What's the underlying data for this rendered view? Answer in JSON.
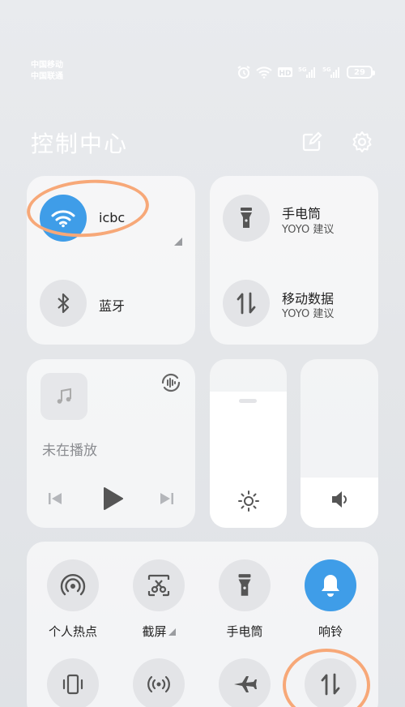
{
  "status_bar": {
    "carrier_1": "中国移动",
    "carrier_2": "中国联通",
    "battery": "29",
    "icons": [
      "alarm-icon",
      "wifi-icon",
      "hd-icon",
      "5g-signal-icon",
      "5g-signal-icon",
      "battery-icon"
    ]
  },
  "header": {
    "title": "控制中心",
    "edit_icon": "edit-icon",
    "settings_icon": "gear-icon"
  },
  "connectivity": {
    "wifi_label": "icbc",
    "wifi_active": true,
    "bluetooth_label": "蓝牙"
  },
  "suggestions": {
    "flashlight_label": "手电筒",
    "flashlight_sub": "YOYO 建议",
    "data_label": "移动数据",
    "data_sub": "YOYO 建议"
  },
  "media": {
    "status": "未在播放"
  },
  "sliders": {
    "brightness_level": 0.81,
    "volume_level": 0.3
  },
  "quick_settings": [
    {
      "label": "个人热点",
      "icon": "hotspot-icon",
      "active": false
    },
    {
      "label": "截屏",
      "icon": "screenshot-icon",
      "active": false
    },
    {
      "label": "手电筒",
      "icon": "flashlight-icon",
      "active": false
    },
    {
      "label": "响铃",
      "icon": "bell-icon",
      "active": true
    }
  ],
  "quick_settings_row2": [
    "vibrate-icon",
    "nfc-icon",
    "airplane-icon",
    "mobile-data-icon"
  ],
  "colors": {
    "accent": "#3f9de8",
    "annotation": "#f7a878"
  }
}
